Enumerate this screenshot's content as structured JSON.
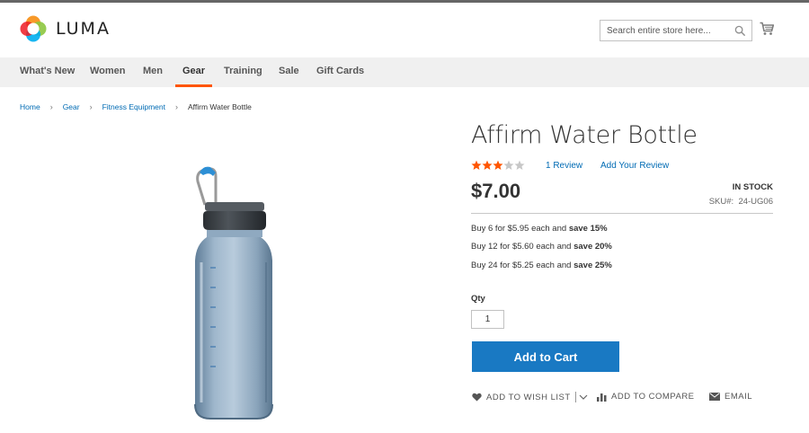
{
  "header": {
    "logo_text": "LUMA",
    "search_placeholder": "Search entire store here...",
    "accent_color": "#ff5501",
    "link_color": "#006bb4",
    "button_color": "#1979c3"
  },
  "nav": {
    "items": [
      {
        "label": "What's New"
      },
      {
        "label": "Women"
      },
      {
        "label": "Men"
      },
      {
        "label": "Gear",
        "active": true
      },
      {
        "label": "Training"
      },
      {
        "label": "Sale"
      },
      {
        "label": "Gift Cards"
      }
    ]
  },
  "breadcrumb": {
    "items": [
      "Home",
      "Gear",
      "Fitness Equipment"
    ],
    "current": "Affirm Water Bottle"
  },
  "product": {
    "title": "Affirm Water Bottle",
    "rating_stars": 3,
    "rating_max": 5,
    "review_count_label": "1 Review",
    "add_review_label": "Add Your Review",
    "price": "$7.00",
    "stock_status": "IN STOCK",
    "sku_label": "SKU#:",
    "sku_value": "24-UG06",
    "tier_prices": [
      {
        "text": "Buy 6 for $5.95 each and ",
        "save": "save 15%"
      },
      {
        "text": "Buy 12 for $5.60 each and ",
        "save": "save 20%"
      },
      {
        "text": "Buy 24 for $5.25 each and ",
        "save": "save 25%"
      }
    ],
    "qty_label": "Qty",
    "qty_value": "1",
    "add_to_cart_label": "Add to Cart"
  },
  "actions": {
    "wishlist_label": "ADD TO WISH LIST",
    "compare_label": "ADD TO COMPARE",
    "email_label": "EMAIL"
  }
}
